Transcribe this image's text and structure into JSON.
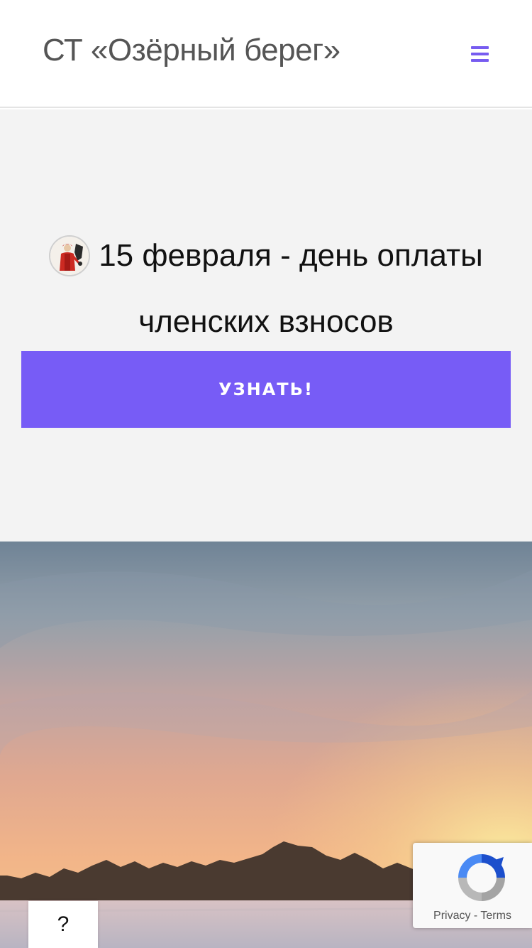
{
  "header": {
    "site_title": "СТ «Озёрный берег»",
    "menu_icon": "hamburger-menu-icon"
  },
  "hero": {
    "announcement_line1": "15 февраля - день оплаты",
    "announcement_line2": "членских взносов",
    "badge_icon": "figure-badge-icon",
    "cta_label": "УЗНАТЬ!"
  },
  "widgets": {
    "help_label": "?",
    "recaptcha_privacy": "Privacy",
    "recaptcha_separator": "-",
    "recaptcha_terms": "Terms"
  },
  "colors": {
    "accent": "#775cf6",
    "hero_background": "#f3f3f3",
    "title_text": "#555555"
  }
}
